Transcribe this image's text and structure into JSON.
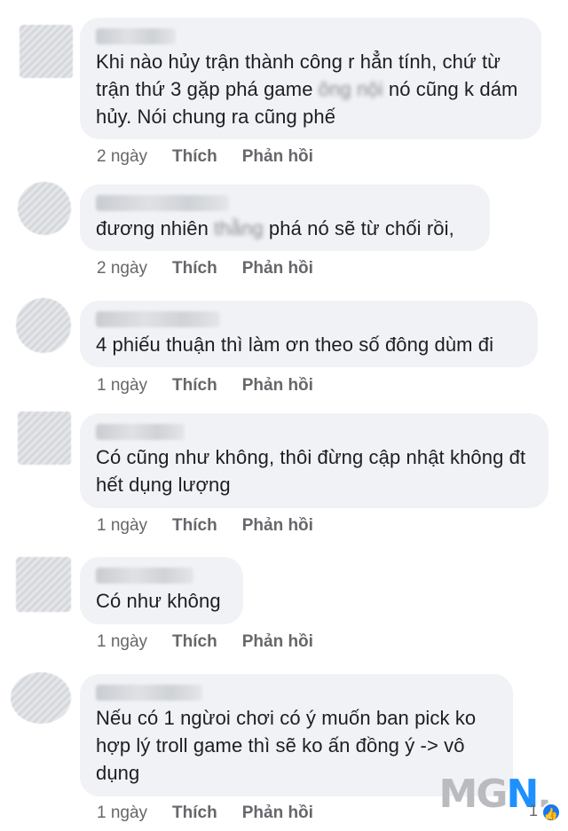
{
  "comments": [
    {
      "text_before": "Khi nào hủy trận thành công r hẳn tính, chứ từ trận thứ 3 gặp phá game ",
      "text_blurred": "ông nội",
      "text_after": " nó cũng k dám hủy. Nói chung ra cũng phế",
      "time": "2 ngày",
      "like": "Thích",
      "reply": "Phản hồi"
    },
    {
      "text_before": "đương nhiên ",
      "text_blurred": "thằng",
      "text_after": " phá nó sẽ từ chối rồi,",
      "time": "2 ngày",
      "like": "Thích",
      "reply": "Phản hồi"
    },
    {
      "text_before": "4 phiếu thuận thì làm ơn theo số đông dùm đi",
      "text_blurred": "",
      "text_after": "",
      "time": "1 ngày",
      "like": "Thích",
      "reply": "Phản hồi"
    },
    {
      "text_before": "Có cũng như không, thôi đừng cập nhật không đt hết dụng lượng",
      "text_blurred": "",
      "text_after": "",
      "time": "1 ngày",
      "like": "Thích",
      "reply": "Phản hồi"
    },
    {
      "text_before": "Có như không",
      "text_blurred": "",
      "text_after": "",
      "time": "1 ngày",
      "like": "Thích",
      "reply": "Phản hồi"
    },
    {
      "text_before": "Nếu có 1 ngừoi chơi có ý muốn ban pick ko hợp lý troll game thì sẽ ko ấn đồng ý -> vô dụng",
      "text_blurred": "",
      "text_after": "",
      "time": "1 ngày",
      "like": "Thích",
      "reply": "Phản hồi",
      "reaction_count": "1",
      "reaction_icon": "like-icon"
    }
  ],
  "watermark": {
    "prefix": "MG",
    "accent": "N",
    "suffix": "."
  },
  "colors": {
    "bubble": "#f0f2f5",
    "meta": "#65676b",
    "text": "#1c1e21",
    "accent": "#1877f2"
  }
}
